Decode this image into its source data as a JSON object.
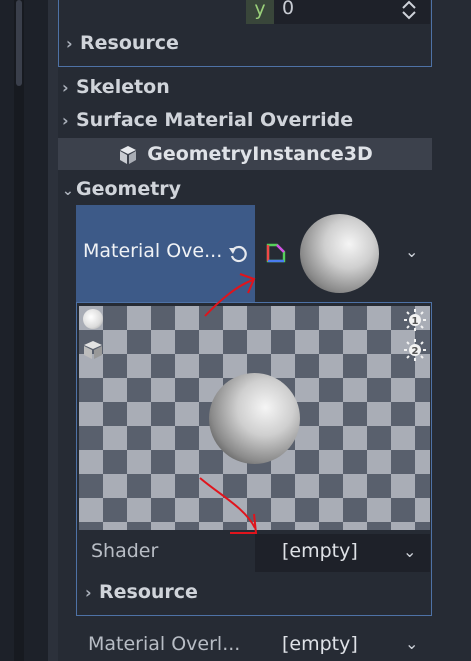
{
  "top_field": {
    "axis_label": "y",
    "value": "0"
  },
  "sections": {
    "resource_top": "Resource",
    "skeleton": "Skeleton",
    "surface_material_override": "Surface Material Override",
    "geometry": "Geometry",
    "resource_sub": "Resource"
  },
  "class_header": {
    "title": "GeometryInstance3D"
  },
  "material_override": {
    "label": "Material Ove..."
  },
  "shader": {
    "label": "Shader",
    "value": "[empty]"
  },
  "material_overlay": {
    "label": "Material Overl...",
    "value": "[empty]"
  },
  "icons": {
    "updown": "updown-arrows-icon",
    "chevron_right": "chevron-right-icon",
    "chevron_down": "chevron-down-icon",
    "cube": "cube-icon",
    "revert": "revert-icon",
    "material": "material-icon",
    "preview_sphere": "sphere-preview-icon",
    "preview_box": "box-preview-icon",
    "light1": "light-1-icon",
    "light2": "light-2-icon"
  },
  "colors": {
    "accent_blue": "#4e72a6",
    "selected_row": "#3d5a88",
    "annotation_red": "#e0141c"
  }
}
